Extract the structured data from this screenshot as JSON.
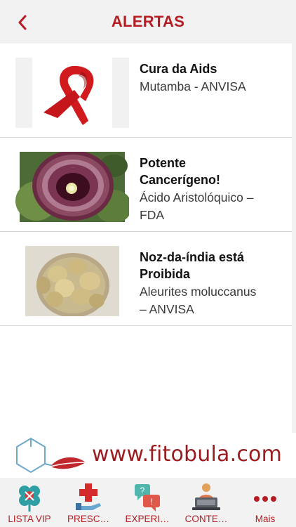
{
  "header": {
    "title": "ALERTAS"
  },
  "alerts": [
    {
      "title": "Cura da Aids",
      "subtitle": "Mutamba - ANVISA",
      "image": "red-ribbon"
    },
    {
      "title_lines": [
        "Potente",
        "Cancerígeno!"
      ],
      "subtitle_lines": [
        "Ácido Aristolóquico –",
        "FDA"
      ],
      "image": "aristolochia-flower"
    },
    {
      "title_lines": [
        "Noz-da-índia está",
        "Proibida"
      ],
      "subtitle_lines": [
        "Aleurites moluccanus",
        "– ANVISA"
      ],
      "image": "nuts-jar"
    }
  ],
  "banner": {
    "text": "www.fitobula.com"
  },
  "tabs": [
    {
      "label": "LISTA VIP",
      "icon": "clover-icon"
    },
    {
      "label": "PRESC…",
      "icon": "prescription-icon"
    },
    {
      "label": "EXPERI…",
      "icon": "chat-bubbles-icon"
    },
    {
      "label": "CONTE…",
      "icon": "laptop-user-icon"
    },
    {
      "label": "Mais",
      "icon": "more-dots-icon"
    }
  ],
  "colors": {
    "accent": "#b51d22",
    "background": "#f2f2f2"
  }
}
